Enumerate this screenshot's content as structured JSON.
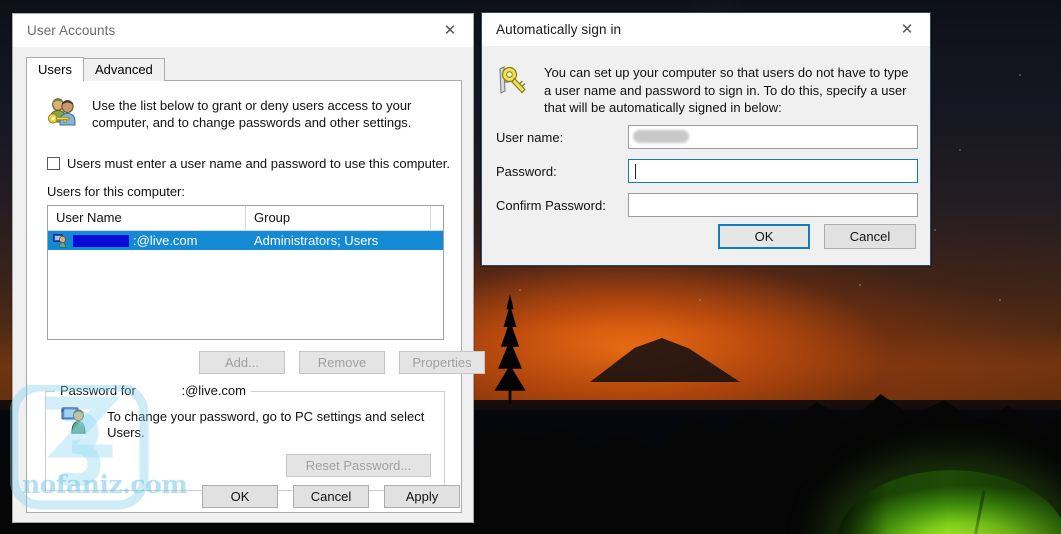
{
  "desktop": {
    "wallpaper_description": "night sky with orange horizon glow, mountain silhouettes, pine tree and illuminated green tent"
  },
  "user_accounts_window": {
    "title": "User Accounts",
    "close_label": "✕",
    "tabs": [
      {
        "label": "Users",
        "active": true
      },
      {
        "label": "Advanced",
        "active": false
      }
    ],
    "description": "Use the list below to grant or deny users access to your computer, and to change passwords and other settings.",
    "require_password_checkbox": {
      "label": "Users must enter a user name and password to use this computer.",
      "checked": false
    },
    "users_list_label": "Users for this computer:",
    "list": {
      "columns": [
        "User Name",
        "Group"
      ],
      "rows": [
        {
          "user_name_redacted": true,
          "user_name_suffix": ":@live.com",
          "group": "Administrators; Users",
          "selected": true
        }
      ]
    },
    "list_buttons": [
      {
        "label": "Add...",
        "enabled": false
      },
      {
        "label": "Remove",
        "enabled": false
      },
      {
        "label": "Properties",
        "enabled": false
      }
    ],
    "password_group": {
      "title_prefix": "Password for",
      "title_suffix": ":@live.com",
      "text": "To change your password, go to PC settings and select Users.",
      "reset_button": {
        "label": "Reset Password...",
        "enabled": false
      }
    },
    "footer_buttons": [
      {
        "label": "OK",
        "enabled": true
      },
      {
        "label": "Cancel",
        "enabled": true
      },
      {
        "label": "Apply",
        "enabled": true
      }
    ],
    "watermark": {
      "text": "nofaniz.com",
      "logo_text": "z3",
      "color": "#68c4e4"
    }
  },
  "auto_sign_in_dialog": {
    "title": "Automatically sign in",
    "close_label": "✕",
    "intro_text": "You can set up your computer so that users do not have to type a user name and password to sign in. To do this, specify a user that will be automatically signed in below:",
    "fields": [
      {
        "label": "User name:",
        "value": "",
        "redacted": true,
        "focused": false
      },
      {
        "label": "Password:",
        "value": "",
        "redacted": false,
        "focused": true
      },
      {
        "label": "Confirm Password:",
        "value": "",
        "redacted": false,
        "focused": false
      }
    ],
    "buttons": [
      {
        "label": "OK",
        "default": true
      },
      {
        "label": "Cancel",
        "default": false
      }
    ]
  },
  "colors": {
    "selection_blue": "#1489d4",
    "focus_blue": "#0f7cbb",
    "window_face": "#f0f0f0",
    "dialog_border": "#2a4a6b"
  }
}
